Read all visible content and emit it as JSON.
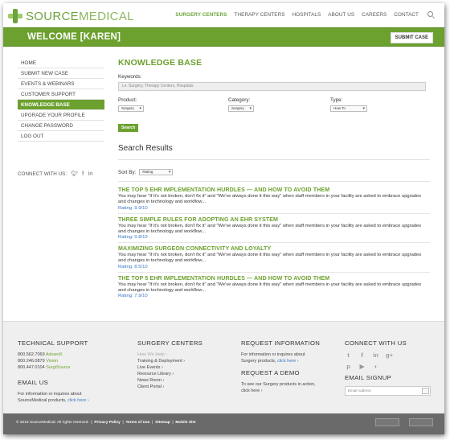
{
  "header": {
    "logo_text_a": "SOURCE",
    "logo_text_b": "MEDICAL",
    "nav": [
      "SURGERY CENTERS",
      "THERAPY CENTERS",
      "HOSPITALS",
      "ABOUT US",
      "CAREERS",
      "CONTACT"
    ],
    "welcome": "WELCOME [KAREN]",
    "submit_label": "SUBMIT CASE"
  },
  "sidebar": {
    "items": [
      {
        "label": "HOME",
        "active": false
      },
      {
        "label": "SUBMIT NEW CASE",
        "active": false
      },
      {
        "label": "EVENTS & WEBINARS",
        "active": false
      },
      {
        "label": "CUSTOMER SUPPORT",
        "active": false
      },
      {
        "label": "KNOWLEDGE BASE",
        "active": true
      },
      {
        "label": "UPGRADE YOUR PROFILE",
        "active": false
      },
      {
        "label": "CHANGE PASSWORD",
        "active": false
      },
      {
        "label": "LOG OUT",
        "active": false
      }
    ],
    "connect_label": "CONNECT WITH US:"
  },
  "main": {
    "title": "KNOWLEDGE BASE",
    "keywords_label": "Keywords:",
    "keywords_placeholder": "i.e. Surgery, Therapy Centers, Hospitals",
    "product_label": "Product:",
    "product_value": "Surgery",
    "category_label": "Category:",
    "category_value": "Surgery",
    "type_label": "Type:",
    "type_value": "How To",
    "search_label": "Search",
    "results_title": "Search Results",
    "sort_label": "Sort By:",
    "sort_value": "Rating"
  },
  "results": [
    {
      "title": "THE TOP 5 EHR IMPLEMENTATION HURDLES — AND HOW TO AVOID THEM",
      "text": "You may hear \"If it's not broken, don't fix it\" and \"We've always done it this way\" when staff members in your facility are asked to embrace upgrades and changes in technology and workflow...",
      "rating": "Rating: 9.9/10"
    },
    {
      "title": "THREE SIMPLE RULES FOR ADOPTING AN EHR SYSTEM",
      "text": "You may hear \"If it's not broken, don't fix it\" and \"We've always done it this way\" when staff members in your facility are asked to embrace upgrades and changes in technology and workflow...",
      "rating": "Rating: 9.8/10"
    },
    {
      "title": "MAXIMIZING SURGEON CONNECTIVITY AND LOYALTY",
      "text": "You may hear \"If it's not broken, don't fix it\" and \"We've always done it this way\" when staff members in your facility are asked to embrace upgrades and changes in technology and workflow...",
      "rating": "Rating: 8.5/10"
    },
    {
      "title": "THE TOP 5 EHR IMPLEMENTATION HURDLES — AND HOW TO AVOID THEM",
      "text": "You may hear \"If it's not broken, don't fix it\" and \"We've always done it this way\" when staff members in your facility are asked to embrace upgrades and changes in technology and workflow...",
      "rating": "Rating: 7.9/10"
    }
  ],
  "footer": {
    "tech_title": "TECHNICAL SUPPORT",
    "phones": [
      {
        "num": "800.562.7069",
        "prod": "AdvantX"
      },
      {
        "num": "800.246.0879",
        "prod": "Vision"
      },
      {
        "num": "800.447.0104",
        "prod": "SurgiSource"
      }
    ],
    "email_title": "EMAIL US",
    "email_text_1": "For information or inquires about",
    "email_text_2": "SourceMedical products,",
    "email_link": "click here ›",
    "surgery_title": "SURGERY CENTERS",
    "surgery_links": [
      "How We Help ›",
      "Training & Deployment ›",
      "Live Events ›",
      "Resource Library ›",
      "News Room ›",
      "Client Portal ›"
    ],
    "request_title": "REQUEST INFORMATION",
    "request_text_1": "For information or inquires about",
    "request_text_2": "Surgery products,",
    "request_link": "click here ›",
    "demo_title": "REQUEST A DEMO",
    "demo_text_1": "To see our Surgery products in action,",
    "demo_link": "click here ›",
    "connect_title": "CONNECT WITH US",
    "signup_title": "EMAIL SIGNUP",
    "email_placeholder": "Email Address",
    "copyright": "© 2015 SourceMedical. All rights reserved.",
    "legal_links": [
      "Privacy Policy",
      "Terms of Use",
      "Sitemap",
      "Mobile Site"
    ]
  },
  "colors": {
    "brand_green": "#6ca12f",
    "link_blue": "#3a76c2",
    "footer_bg": "#efefef",
    "bottom_bar": "#6a6a6a"
  }
}
